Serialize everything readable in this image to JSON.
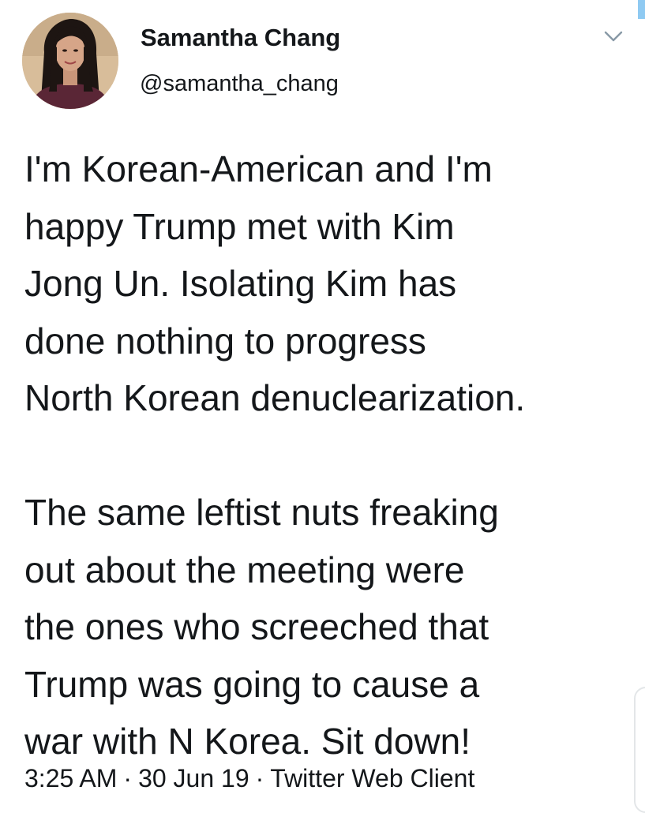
{
  "tweet": {
    "author": {
      "display_name": "Samantha Chang",
      "handle": "@samantha_chang"
    },
    "body": {
      "paragraphs": [
        {
          "lines": [
            "I'm Korean-American and I'm",
            "happy Trump met with Kim",
            "Jong Un. Isolating Kim has",
            "done nothing to progress",
            "North Korean denuclearization."
          ]
        },
        {
          "lines": [
            "The same leftist nuts freaking",
            "out about the meeting were",
            "the ones who screeched that",
            "Trump was going to cause a",
            "war with N Korea. Sit down!"
          ]
        }
      ]
    },
    "meta": {
      "time": "3:25 AM",
      "separator": "·",
      "date": "30 Jun 19",
      "client": "Twitter Web Client"
    },
    "icons": {
      "more_menu": "chevron-down-icon",
      "avatar": "profile-photo"
    },
    "colors": {
      "text": "#14171a",
      "chevron": "#8899a6",
      "accent": "#8fcaf2"
    }
  }
}
